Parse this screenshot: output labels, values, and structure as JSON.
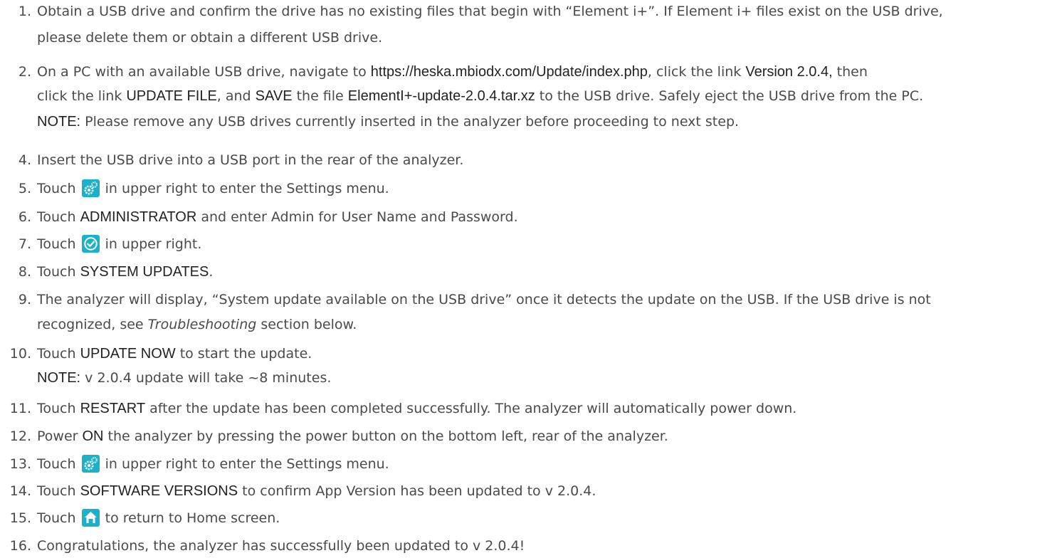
{
  "steps": [
    {
      "num": "1.",
      "l1": "Obtain a USB drive and confirm the drive has no existing files that begin with “Element i+”. If Element i+ files exist on the USB drive,",
      "l2": "please delete them or obtain a different USB drive."
    },
    {
      "num": "2.",
      "a": "On a PC with an available USB drive, navigate to ",
      "url": "https://heska.mbiodx.com/Update/index.php",
      "b": ", click  the link ",
      "ver": "Version 2.0.4,",
      "c": " then",
      "d": "click the link ",
      "upd": "UPDATE FILE",
      "e": ", and ",
      "save": "SAVE",
      "f": " the file ",
      "file": "ElementI+-update-2.0.4.tar.xz",
      "g": " to the USB drive. Safely eject the USB drive from the PC.",
      "note_label": "NOTE:",
      "note_text": " Please remove any USB drives currently inserted in the analyzer before proceeding to next step."
    },
    {
      "num": "4.",
      "text": "Insert the USB drive into a USB port in the rear of the analyzer."
    },
    {
      "num": "5.",
      "a": "Touch ",
      "b": " in upper right to enter the Settings menu."
    },
    {
      "num": "6.",
      "a": "Touch ",
      "k": "ADMINISTRATOR",
      "b": " and enter Admin for User Name and Password."
    },
    {
      "num": "7.",
      "a": "Touch ",
      "b": " in upper right."
    },
    {
      "num": "8.",
      "a": "Touch ",
      "k": "SYSTEM UPDATES",
      "b": "."
    },
    {
      "num": "9.",
      "l1": "The analyzer will display, “System update available on the USB drive” once it detects the update on the USB. If the USB drive is not",
      "l2a": "recognized, see ",
      "l2em": "Troubleshooting",
      "l2b": " section below."
    },
    {
      "num": "10.",
      "a": "Touch ",
      "k": "UPDATE NOW",
      "b": " to start the update.",
      "note_label": "NOTE:",
      "note_text": " v 2.0.4 update will take ~8 minutes."
    },
    {
      "num": "11.",
      "a": "Touch ",
      "k": "RESTART",
      "b": " after the update has been completed successfully. The analyzer will automatically power down."
    },
    {
      "num": "12.",
      "a": "Power ",
      "k": "ON",
      "b": " the analyzer by pressing the power button on the bottom left, rear of the analyzer."
    },
    {
      "num": "13.",
      "a": "Touch ",
      "b": " in upper right to enter the Settings menu."
    },
    {
      "num": "14.",
      "a": "Touch ",
      "k": "SOFTWARE VERSIONS",
      "b": " to confirm App Version has been updated to v 2.0.4."
    },
    {
      "num": "15.",
      "a": "Touch ",
      "b": " to return to Home screen."
    },
    {
      "num": "16.",
      "text": "Congratulations, the analyzer has successfully been updated to v 2.0.4!"
    }
  ],
  "icons": {
    "settings": "gears-icon",
    "confirm": "checkmark-circle-icon",
    "home": "home-icon"
  },
  "colors": {
    "icon_bg": "#1ab2c9",
    "text": "#4a4a4a",
    "emphasis": "#222222"
  }
}
